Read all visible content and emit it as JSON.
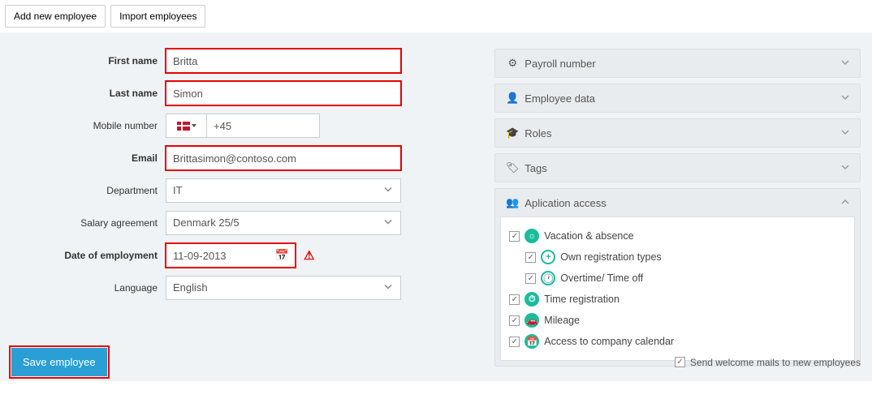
{
  "topButtons": {
    "addEmployee": "Add new employee",
    "importEmployees": "Import employees"
  },
  "form": {
    "firstName": {
      "label": "First name",
      "value": "Britta"
    },
    "lastName": {
      "label": "Last name",
      "value": "Simon"
    },
    "mobile": {
      "label": "Mobile number",
      "prefix": "+45"
    },
    "email": {
      "label": "Email",
      "value": "Brittasimon@contoso.com"
    },
    "department": {
      "label": "Department",
      "value": "IT"
    },
    "salaryAgreement": {
      "label": "Salary agreement",
      "value": "Denmark 25/5"
    },
    "dateOfEmployment": {
      "label": "Date of employment",
      "value": "11-09-2013"
    },
    "language": {
      "label": "Language",
      "value": "English"
    }
  },
  "panels": {
    "payrollNumber": "Payroll number",
    "employeeData": "Employee data",
    "roles": "Roles",
    "tags": "Tags",
    "applicationAccess": "Aplication access"
  },
  "appAccess": {
    "vacation": "Vacation & absence",
    "ownTypes": "Own registration types",
    "overtime": "Overtime/ Time off",
    "timeReg": "Time registration",
    "mileage": "Mileage",
    "calendar": "Access to company calendar"
  },
  "footer": {
    "saveButton": "Save employee",
    "welcomeMails": "Send welcome mails to new employees"
  }
}
